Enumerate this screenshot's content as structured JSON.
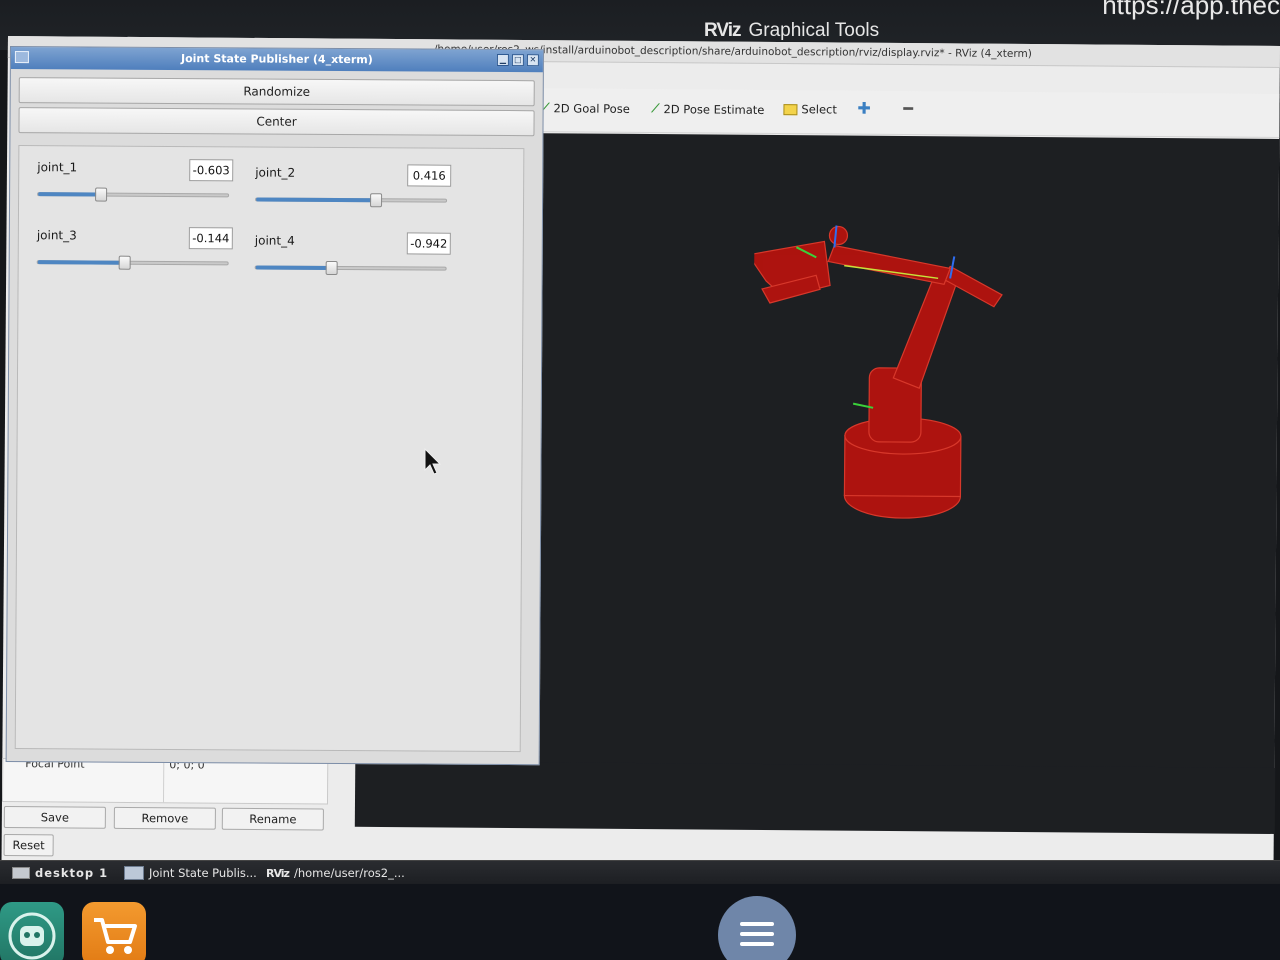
{
  "screen": {
    "url_fragment": "https://app.thec",
    "app_title_logo": "RViz",
    "app_title": "Graphical Tools"
  },
  "rviz": {
    "window_title": "/home/user/ros2_ws/install/arduinobot_description/share/arduinobot_description/rviz/display.rviz* - RViz (4_xterm)",
    "tools": [
      {
        "label": "2D Goal Pose",
        "icon": "pose-arrow-icon"
      },
      {
        "label": "2D Pose Estimate",
        "icon": "pose-arrow-icon"
      },
      {
        "label": "Select",
        "icon": "select-icon"
      },
      {
        "label": "",
        "icon": "plus-icon"
      },
      {
        "label": "",
        "icon": "minus-icon"
      }
    ],
    "displays_panel": {
      "property_name": "Focal Point",
      "property_value": "0; 0; 0"
    },
    "buttons": {
      "save": "Save",
      "remove": "Remove",
      "rename": "Rename",
      "reset": "Reset"
    },
    "viewport_background": "#1d1f22",
    "robot_color": "#c8140f"
  },
  "jsp": {
    "title": "Joint State Publisher (4_xterm)",
    "randomize": "Randomize",
    "center": "Center",
    "joints": [
      {
        "name": "joint_1",
        "value": "-0.603",
        "slider_fraction": 0.33
      },
      {
        "name": "joint_2",
        "value": "0.416",
        "slider_fraction": 0.63
      },
      {
        "name": "joint_3",
        "value": "-0.144",
        "slider_fraction": 0.46
      },
      {
        "name": "joint_4",
        "value": "-0.942",
        "slider_fraction": 0.4
      }
    ],
    "accent_color": "#4f7fbd"
  },
  "taskbar": {
    "desktop": "desktop 1",
    "tasks": [
      {
        "label": "Joint State Publis..."
      },
      {
        "label": "/home/user/ros2_...",
        "icon_text": "RViz"
      }
    ]
  }
}
